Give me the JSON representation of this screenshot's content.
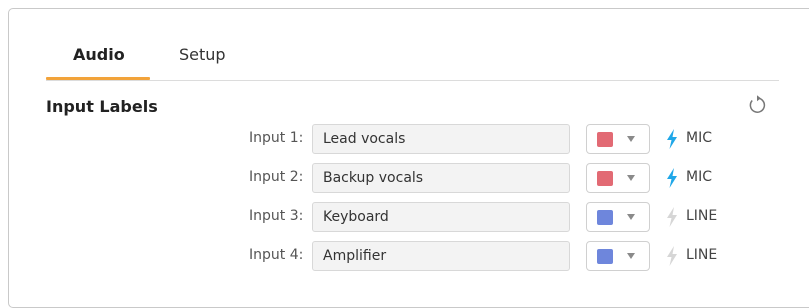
{
  "tabs": [
    {
      "label": "Audio",
      "active": true
    },
    {
      "label": "Setup",
      "active": false
    }
  ],
  "section": {
    "title": "Input Labels"
  },
  "reset_icon": "reset-icon",
  "inputs": [
    {
      "label": "Input 1:",
      "value": "Lead vocals",
      "color": "#e26a74",
      "level": "MIC",
      "phantom": true
    },
    {
      "label": "Input 2:",
      "value": "Backup vocals",
      "color": "#e26a74",
      "level": "MIC",
      "phantom": true
    },
    {
      "label": "Input 3:",
      "value": "Keyboard",
      "color": "#6e86dc",
      "level": "LINE",
      "phantom": false
    },
    {
      "label": "Input 4:",
      "value": "Amplifier",
      "color": "#6e86dc",
      "level": "LINE",
      "phantom": false
    }
  ],
  "colors": {
    "accent_tab": "#f2a33a",
    "bolt_active": "#1fa7e8",
    "bolt_inactive": "#d6d6d6"
  }
}
